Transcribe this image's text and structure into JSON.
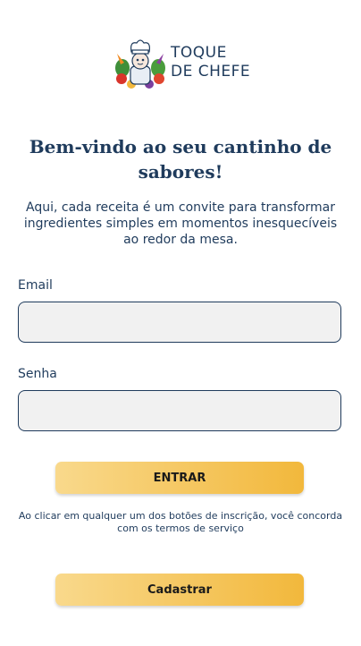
{
  "brand": {
    "name_line1": "TOQUE",
    "name_line2": "DE CHEFE",
    "logo_icon": "chef-with-vegetables-icon"
  },
  "welcome": {
    "title": "Bem-vindo ao seu cantinho de sabores!",
    "text": "Aqui, cada receita é um convite para transformar ingredientes simples em momentos inesquecíveis ao redor da mesa."
  },
  "form": {
    "email_label": "Email",
    "email_value": "",
    "password_label": "Senha",
    "password_value": "",
    "login_button": "ENTRAR",
    "terms": "Ao clicar em qualquer um dos botões de inscrição, você concorda com os termos de serviço",
    "signup_button": "Cadastrar"
  },
  "colors": {
    "text": "#1f3b5c",
    "button_gradient_start": "#f9d98c",
    "button_gradient_end": "#f2b83c",
    "input_bg": "#f1f1f1"
  }
}
